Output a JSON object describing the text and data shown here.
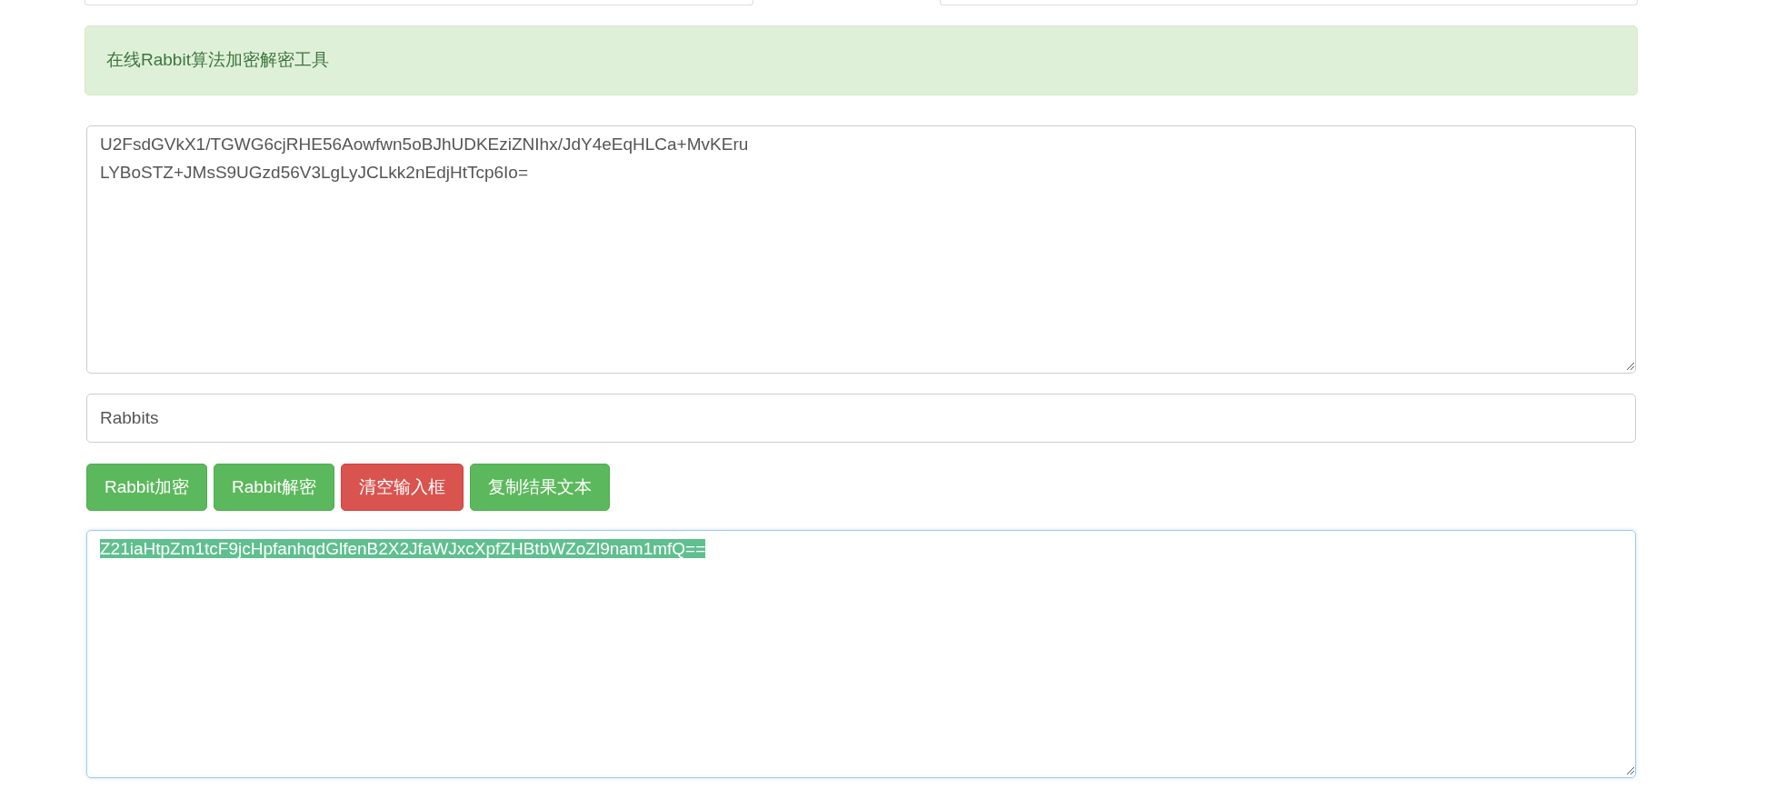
{
  "alert": {
    "text": "在线Rabbit算法加密解密工具"
  },
  "input_text": {
    "value": "U2FsdGVkX1/TGWG6cjRHE56Aowfwn5oBJhUDKEziZNIhx/JdY4eEqHLCa+MvKEru\nLYBoSTZ+JMsS9UGzd56V3LgLyJCLkk2nEdjHtTcp6Io="
  },
  "key_field": {
    "value": "Rabbits"
  },
  "buttons": [
    {
      "label": "Rabbit加密",
      "kind": "success"
    },
    {
      "label": "Rabbit解密",
      "kind": "success"
    },
    {
      "label": "清空输入框",
      "kind": "danger"
    },
    {
      "label": "复制结果文本",
      "kind": "success"
    }
  ],
  "output_text": {
    "value": "Z21iaHtpZm1tcF9jcHpfanhqdGlfenB2X2JfaWJxcXpfZHBtbWZoZl9nam1mfQ==",
    "selected": true
  }
}
